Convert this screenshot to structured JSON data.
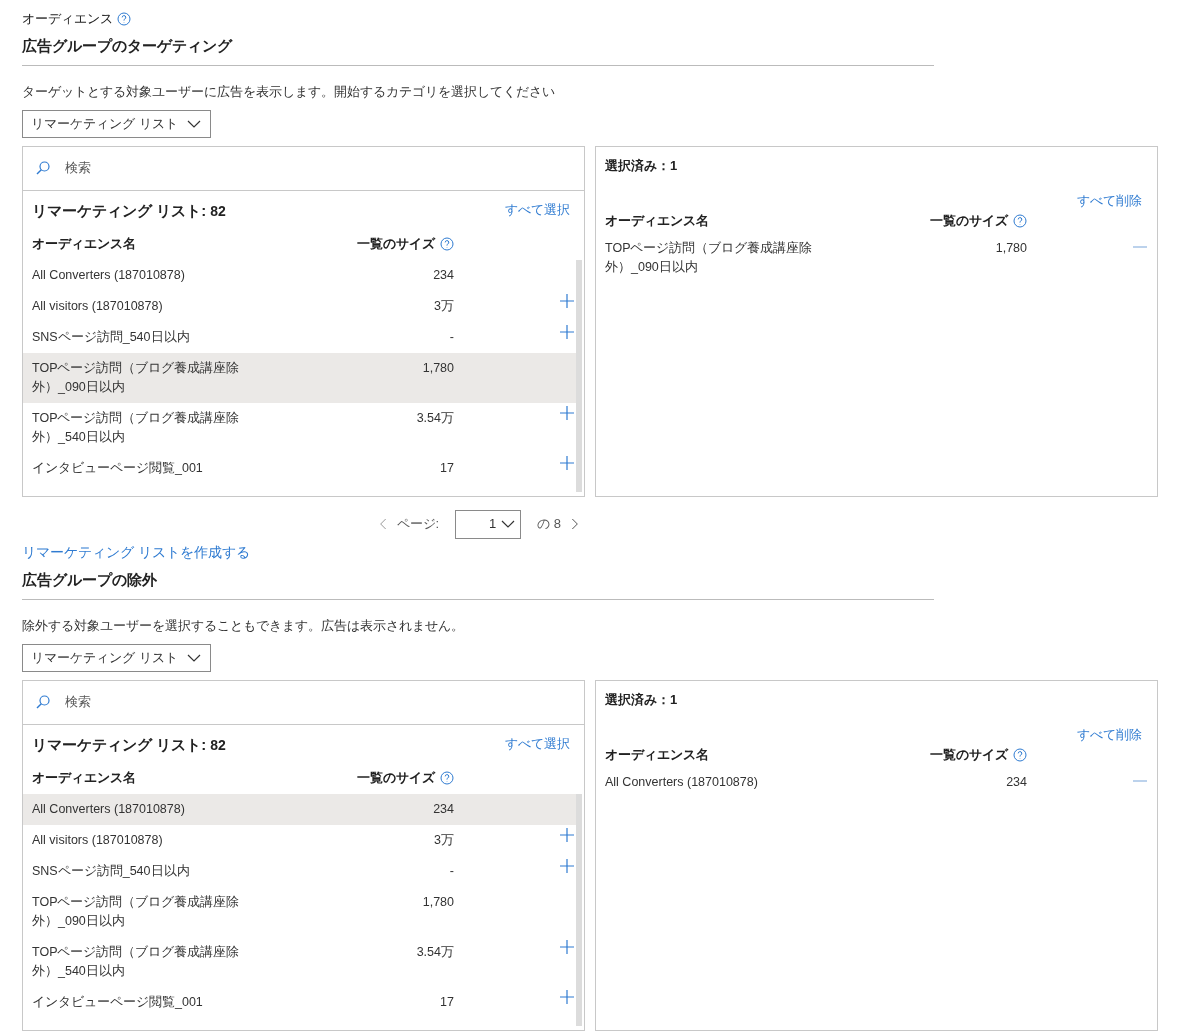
{
  "audience_label": "オーディエンス",
  "sections": [
    {
      "title": "広告グループのターゲティング",
      "description": "ターゲットとする対象ユーザーに広告を表示します。開始するカテゴリを選択してください",
      "category_dropdown": "リマーケティング リスト",
      "search": {
        "placeholder": "検索"
      },
      "list_title": "リマーケティング リスト:",
      "list_count": "82",
      "select_all": "すべて選択",
      "columns": [
        "オーディエンス名",
        "一覧のサイズ"
      ],
      "rows": [
        {
          "name": "All Converters (187010878)",
          "size": "234",
          "selected": false,
          "can_add": false
        },
        {
          "name": "All visitors (187010878)",
          "size": "3万",
          "selected": false,
          "can_add": true
        },
        {
          "name": "SNSページ訪問_540日以内",
          "size": "-",
          "selected": false,
          "can_add": true
        },
        {
          "name": "TOPページ訪問（ブログ養成講座除外）_090日以内",
          "size": "1,780",
          "selected": true,
          "can_add": false
        },
        {
          "name": "TOPページ訪問（ブログ養成講座除外）_540日以内",
          "size": "3.54万",
          "selected": false,
          "can_add": true
        },
        {
          "name": "インタビューページ閲覧_001",
          "size": "17",
          "selected": false,
          "can_add": true
        }
      ],
      "selected_panel": {
        "title": "選択済み：1",
        "remove_all": "すべて削除",
        "columns": [
          "オーディエンス名",
          "一覧のサイズ"
        ],
        "rows": [
          {
            "name": "TOPページ訪問（ブログ養成講座除外）_090日以内",
            "size": "1,780"
          }
        ]
      },
      "pagination": {
        "label": "ページ:",
        "page": "1",
        "total": "の 8"
      },
      "create_link": "リマーケティング リストを作成する"
    },
    {
      "title": "広告グループの除外",
      "description": "除外する対象ユーザーを選択することもできます。広告は表示されません。",
      "category_dropdown": "リマーケティング リスト",
      "search": {
        "placeholder": "検索"
      },
      "list_title": "リマーケティング リスト:",
      "list_count": "82",
      "select_all": "すべて選択",
      "columns": [
        "オーディエンス名",
        "一覧のサイズ"
      ],
      "rows": [
        {
          "name": "All Converters (187010878)",
          "size": "234",
          "selected": true,
          "can_add": false
        },
        {
          "name": "All visitors (187010878)",
          "size": "3万",
          "selected": false,
          "can_add": true
        },
        {
          "name": "SNSページ訪問_540日以内",
          "size": "-",
          "selected": false,
          "can_add": true
        },
        {
          "name": "TOPページ訪問（ブログ養成講座除外）_090日以内",
          "size": "1,780",
          "selected": false,
          "can_add": false
        },
        {
          "name": "TOPページ訪問（ブログ養成講座除外）_540日以内",
          "size": "3.54万",
          "selected": false,
          "can_add": true
        },
        {
          "name": "インタビューページ閲覧_001",
          "size": "17",
          "selected": false,
          "can_add": true
        }
      ],
      "selected_panel": {
        "title": "選択済み：1",
        "remove_all": "すべて削除",
        "columns": [
          "オーディエンス名",
          "一覧のサイズ"
        ],
        "rows": [
          {
            "name": "All Converters (187010878)",
            "size": "234"
          }
        ]
      }
    }
  ]
}
